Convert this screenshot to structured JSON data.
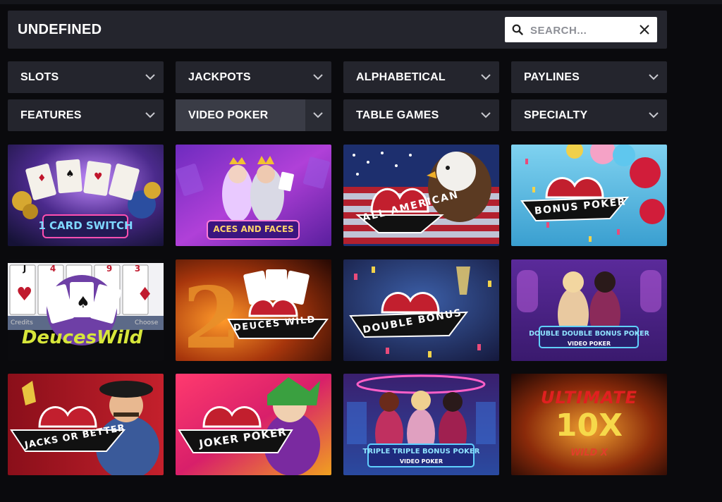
{
  "header": {
    "title": "UNDEFINED",
    "search_placeholder": "SEARCH..."
  },
  "filters": [
    {
      "label": "SLOTS"
    },
    {
      "label": "JACKPOTS"
    },
    {
      "label": "ALPHABETICAL"
    },
    {
      "label": "PAYLINES"
    },
    {
      "label": "FEATURES"
    },
    {
      "label": "VIDEO POKER",
      "active": true
    },
    {
      "label": "TABLE GAMES"
    },
    {
      "label": "SPECIALTY"
    }
  ],
  "games": [
    {
      "title": "1 CARD SWITCH"
    },
    {
      "title": "ACES AND FACES"
    },
    {
      "title": "ALL AMERICAN"
    },
    {
      "title": "BONUS POKER"
    },
    {
      "title": "DeucesWild",
      "card_ranks": [
        "J",
        "4",
        "9",
        "3"
      ],
      "credits_label": "Credits",
      "choose_label": "Choose"
    },
    {
      "title": "DEUCES WILD"
    },
    {
      "title": "DOUBLE BONUS"
    },
    {
      "title": "DOUBLE DOUBLE BONUS POKER",
      "subtitle": "VIDEO POKER"
    },
    {
      "title": "JACKS OR BETTER"
    },
    {
      "title": "JOKER POKER"
    },
    {
      "title": "TRIPLE TRIPLE BONUS POKER",
      "subtitle": "VIDEO POKER"
    },
    {
      "title": "ULTIMATE",
      "big": "10X",
      "wild": "WILD X"
    }
  ],
  "colors": {
    "panel": "#24252d",
    "active_filter": "#3a3c46",
    "background": "#0a0a0d"
  },
  "icons": {
    "search": "magnifier",
    "clear": "x-mark",
    "dropdown": "chevron-down"
  }
}
